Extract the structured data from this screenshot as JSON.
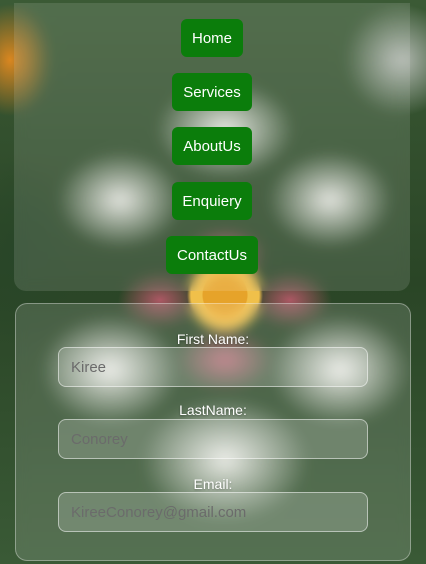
{
  "nav": {
    "items": [
      {
        "label": "Home"
      },
      {
        "label": "Services"
      },
      {
        "label": "AboutUs"
      },
      {
        "label": "Enquiery"
      },
      {
        "label": "ContactUs"
      }
    ],
    "button_color": "#0b7d0b"
  },
  "form": {
    "first_name": {
      "label": "First Name:",
      "value": "Kiree"
    },
    "last_name": {
      "label": "LastName:",
      "value": "Conorey"
    },
    "email": {
      "label": "Email:",
      "value": "KireeConorey@gmail.com"
    }
  }
}
